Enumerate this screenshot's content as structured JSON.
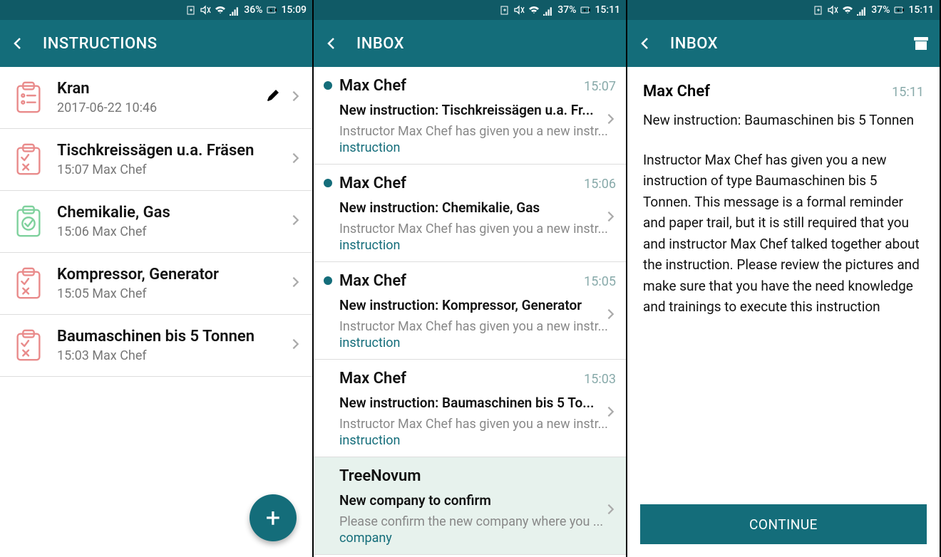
{
  "colors": {
    "accent": "#146d7a",
    "accent_dark": "#105a66"
  },
  "screen1": {
    "status": {
      "battery_pct": "36%",
      "time": "15:09",
      "charging_icon": "battery-charging-icon"
    },
    "appbar": {
      "title": "INSTRUCTIONS"
    },
    "items": [
      {
        "title": "Kran",
        "sub": "2017-06-22 10:46",
        "icon_variant": "list",
        "icon_color": "#e98b8b",
        "editable": true
      },
      {
        "title": "Tischkreissägen u.a. Fräsen",
        "sub": "15:07  Max Chef",
        "icon_variant": "check-x",
        "icon_color": "#e98b8b",
        "editable": false
      },
      {
        "title": "Chemikalie, Gas",
        "sub": "15:06  Max Chef",
        "icon_variant": "ok",
        "icon_color": "#7fd19d",
        "editable": false
      },
      {
        "title": "Kompressor, Generator",
        "sub": "15:05  Max Chef",
        "icon_variant": "check-x",
        "icon_color": "#e98b8b",
        "editable": false
      },
      {
        "title": "Baumaschinen bis 5 Tonnen",
        "sub": "15:03  Max Chef",
        "icon_variant": "check-x",
        "icon_color": "#e98b8b",
        "editable": false
      }
    ]
  },
  "screen2": {
    "status": {
      "battery_pct": "37%",
      "time": "15:11",
      "charging_icon": "battery-charging-icon"
    },
    "appbar": {
      "title": "INBOX"
    },
    "messages": [
      {
        "unread": true,
        "sender": "Max Chef",
        "time": "15:07",
        "subject": "New instruction: Tischkreissägen u.a. Fr...",
        "preview": "Instructor Max Chef has given you a new instr...",
        "link": "instruction"
      },
      {
        "unread": true,
        "sender": "Max Chef",
        "time": "15:06",
        "subject": "New instruction: Chemikalie, Gas",
        "preview": "Instructor Max Chef has given you a new instr...",
        "link": "instruction"
      },
      {
        "unread": true,
        "sender": "Max Chef",
        "time": "15:05",
        "subject": "New instruction: Kompressor, Generator",
        "preview": "Instructor Max Chef has given you a new instr...",
        "link": "instruction"
      },
      {
        "unread": false,
        "sender": "Max Chef",
        "time": "15:03",
        "subject": "New instruction: Baumaschinen bis 5 To...",
        "preview": "Instructor Max Chef has given you a new instr...",
        "link": "instruction"
      },
      {
        "unread": false,
        "sender": "TreeNovum",
        "time": "",
        "subject": "New company to confirm",
        "preview": "Please confirm the new company where you ...",
        "link": "company",
        "selected": true
      }
    ]
  },
  "screen3": {
    "status": {
      "battery_pct": "37%",
      "time": "15:11",
      "charging_icon": "battery-charging-icon"
    },
    "appbar": {
      "title": "INBOX",
      "archive_icon": "archive-icon"
    },
    "sender": "Max Chef",
    "time": "15:11",
    "subject": "New instruction: Baumaschinen bis 5 Tonnen",
    "body": "Instructor Max Chef has given you a new instruction of type Baumaschinen bis 5 Tonnen. This message is a formal reminder and paper trail, but it is still required that you and instructor Max Chef talked together about the instruction. Please review the pictures and make sure that you have the need knowledge and trainings to execute this instruction",
    "continue_label": "CONTINUE"
  }
}
